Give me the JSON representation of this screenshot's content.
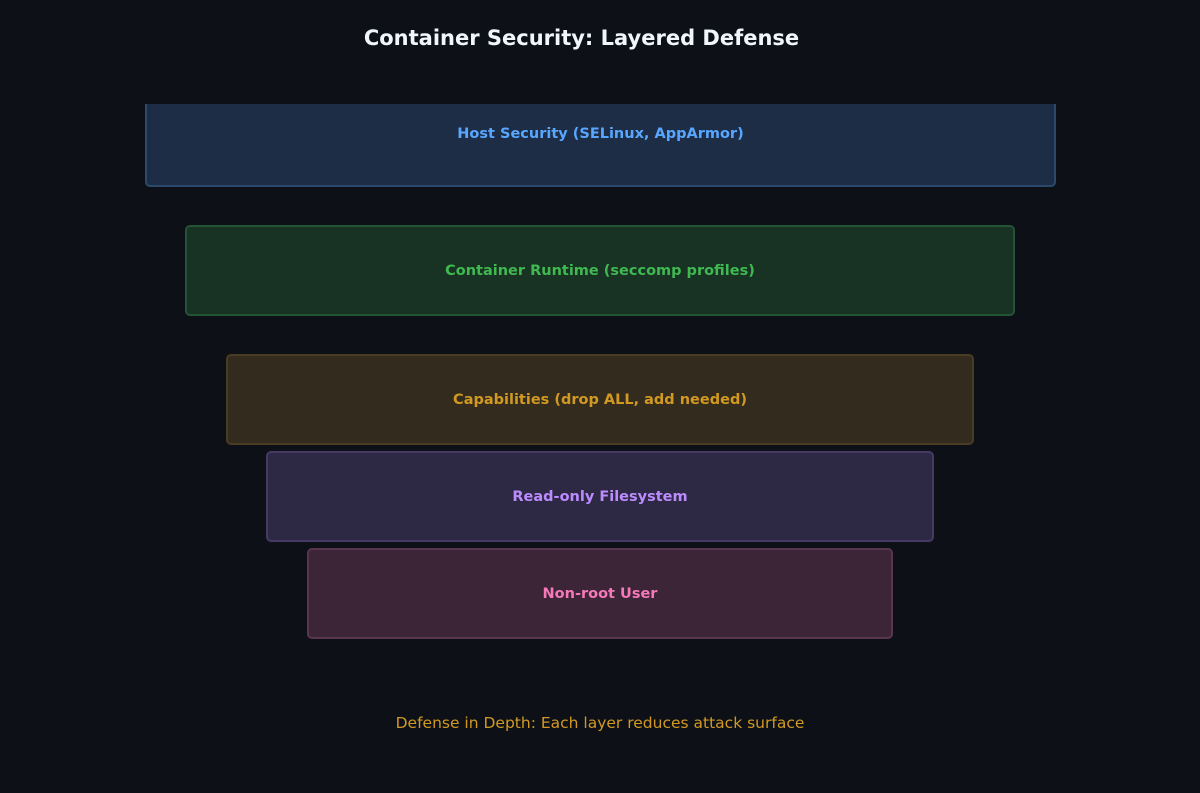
{
  "title": "Container Security: Layered Defense",
  "layers": [
    {
      "label": "Host Security (SELinux, AppArmor)",
      "text_color": "#58a6ff",
      "fill": "#1c2d45",
      "border": "#2b4a6e"
    },
    {
      "label": "Container Runtime (seccomp profiles)",
      "text_color": "#3fb950",
      "fill": "#183324",
      "border": "#245436"
    },
    {
      "label": "Capabilities (drop ALL, add needed)",
      "text_color": "#d29922",
      "fill": "#332c1e",
      "border": "#4a3c22"
    },
    {
      "label": "Read-only Filesystem",
      "text_color": "#bc8cff",
      "fill": "#2d2944",
      "border": "#443a63"
    },
    {
      "label": "Non-root User",
      "text_color": "#f778ba",
      "fill": "#3c2537",
      "border": "#5a3550"
    }
  ],
  "footer": {
    "text": "Defense in Depth: Each layer reduces attack surface",
    "color": "#d29922"
  }
}
